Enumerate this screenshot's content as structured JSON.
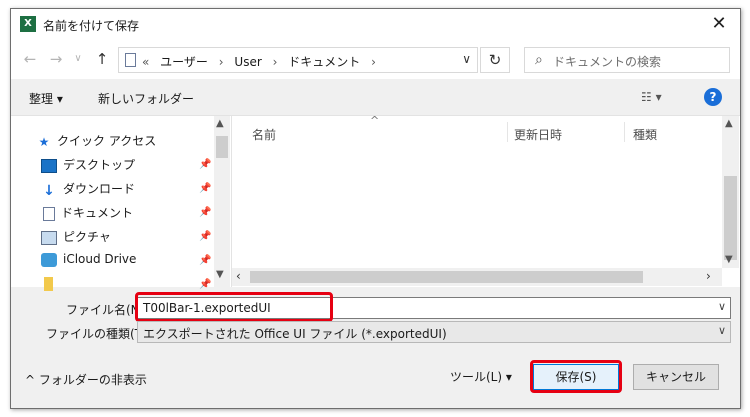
{
  "window": {
    "title": "名前を付けて保存",
    "app_icon": "excel-icon",
    "close_glyph": "✕"
  },
  "nav": {
    "back_glyph": "←",
    "forward_glyph": "→",
    "recent_glyph": "∨",
    "up_glyph": "↑",
    "breadcrumbs": [
      "«",
      "ユーザー",
      "›",
      "User",
      "›",
      "ドキュメント",
      "›"
    ],
    "address_dropdown_glyph": "∨",
    "refresh_glyph": "↻",
    "search_placeholder": "ドキュメントの検索"
  },
  "toolbar": {
    "organize_label": "整理 ▾",
    "new_folder_label": "新しいフォルダー",
    "view_label": "☷ ▾",
    "help_label": "?"
  },
  "sidebar": {
    "items": [
      {
        "label": "クイック アクセス",
        "icon": "star-icon"
      },
      {
        "label": "デスクトップ",
        "icon": "desktop-icon"
      },
      {
        "label": "ダウンロード",
        "icon": "download-icon"
      },
      {
        "label": "ドキュメント",
        "icon": "document-icon"
      },
      {
        "label": "ピクチャ",
        "icon": "pictures-icon"
      },
      {
        "label": "iCloud Drive",
        "icon": "icloud-icon"
      },
      {
        "label": "",
        "icon": "folder-icon"
      }
    ]
  },
  "file_list": {
    "columns": [
      "名前",
      "更新日時",
      "種類"
    ]
  },
  "form": {
    "filename_label": "ファイル名(N):",
    "filename_value": "T00lBar-1.exportedUI",
    "filetype_label": "ファイルの種類(T):",
    "filetype_value": "エクスポートされた Office UI ファイル (*.exportedUI)"
  },
  "footer": {
    "hide_folders_label": "^ フォルダーの非表示",
    "tools_label": "ツール(L)   ▾",
    "save_label": "保存(S)",
    "cancel_label": "キャンセル"
  },
  "colors": {
    "highlight": "#e60012",
    "save_border": "#0078d7",
    "help": "#1a6ed8"
  }
}
